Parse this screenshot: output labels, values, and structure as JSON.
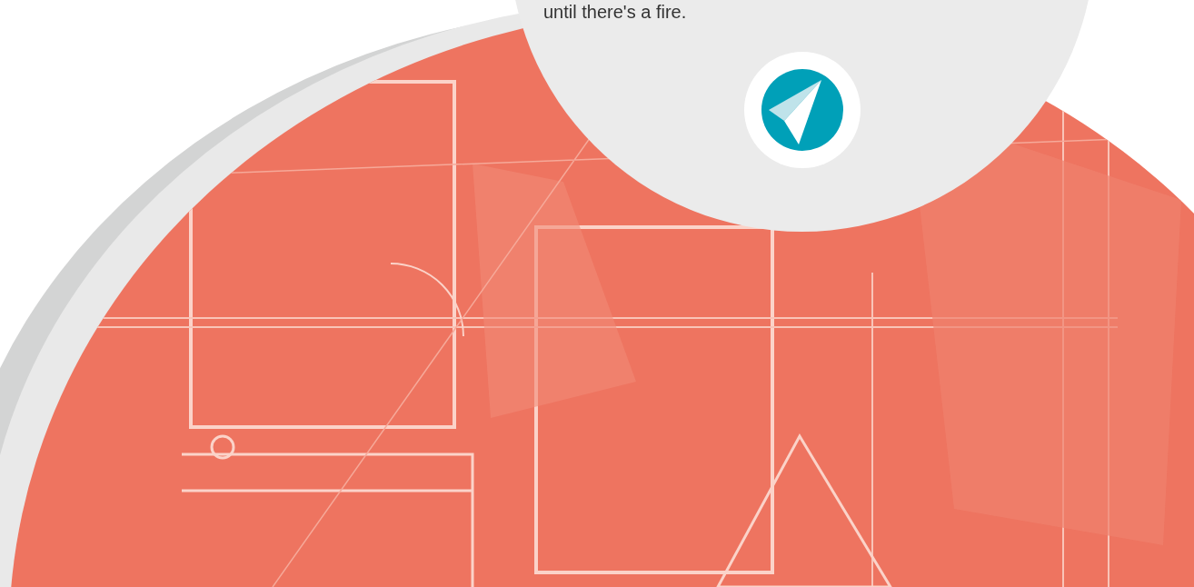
{
  "callout": {
    "text": "until there's a fire."
  }
}
